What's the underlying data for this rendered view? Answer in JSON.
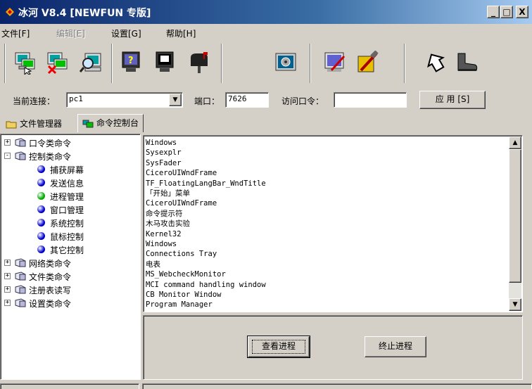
{
  "window": {
    "title": "冰河 V8.4 [NEWFUN 专版]",
    "controls": {
      "minimize": "_",
      "maximize": "□",
      "close": "X"
    }
  },
  "menu": {
    "items": [
      {
        "label": "文件[F]",
        "enabled": true
      },
      {
        "label": "编辑[E]",
        "enabled": false
      },
      {
        "label": "设置[G]",
        "enabled": true
      },
      {
        "label": "帮助[H]",
        "enabled": true
      }
    ]
  },
  "toolbar": {
    "buttons": [
      {
        "icon": "connect-computer-icon"
      },
      {
        "icon": "disconnect-computer-icon"
      },
      {
        "icon": "search-computer-icon"
      },
      {
        "icon": "computer-help-icon"
      },
      {
        "icon": "monitor-icon"
      },
      {
        "icon": "mailbox-icon"
      },
      {
        "icon": "control-panel-icon"
      },
      {
        "icon": "edit-config-icon"
      },
      {
        "icon": "tools-icon"
      },
      {
        "icon": "arrow-icon"
      },
      {
        "icon": "boot-icon"
      }
    ]
  },
  "connection": {
    "current_label": "当前连接：",
    "current_value": "pc1",
    "port_label": "端口：",
    "port_value": "7626",
    "password_label": "访问口令：",
    "password_value": "",
    "apply_label": "应 用 [S]"
  },
  "tabs": [
    {
      "label": "文件管理器",
      "active": false
    },
    {
      "label": "命令控制台",
      "active": true
    }
  ],
  "tree": {
    "items": [
      {
        "label": "口令类命令",
        "level": 0,
        "expander": "+"
      },
      {
        "label": "控制类命令",
        "level": 0,
        "expander": "-"
      },
      {
        "label": "捕获屏幕",
        "level": 1,
        "dot": "#0000cc"
      },
      {
        "label": "发送信息",
        "level": 1,
        "dot": "#0000cc"
      },
      {
        "label": "进程管理",
        "level": 1,
        "dot": "#00aa00"
      },
      {
        "label": "窗口管理",
        "level": 1,
        "dot": "#0000cc"
      },
      {
        "label": "系统控制",
        "level": 1,
        "dot": "#0000cc"
      },
      {
        "label": "鼠标控制",
        "level": 1,
        "dot": "#0000cc"
      },
      {
        "label": "其它控制",
        "level": 1,
        "dot": "#0000cc"
      },
      {
        "label": "网络类命令",
        "level": 0,
        "expander": "+"
      },
      {
        "label": "文件类命令",
        "level": 0,
        "expander": "+"
      },
      {
        "label": "注册表读写",
        "level": 0,
        "expander": "+"
      },
      {
        "label": "设置类命令",
        "level": 0,
        "expander": "+"
      }
    ]
  },
  "window_list": [
    "Windows",
    "Sysexplr",
    "SysFader",
    "CiceroUIWndFrame",
    "TF_FloatingLangBar_WndTitle",
    "「开始」菜单",
    "CiceroUIWndFrame",
    "命令提示符",
    "木马攻击实验",
    "Kernel32",
    "Windows",
    "Connections Tray",
    "电表",
    "MS_WebcheckMonitor",
    "MCI command handling window",
    "CB Monitor Window",
    "Program Manager"
  ],
  "actions": {
    "view_process": "查看进程",
    "kill_process": "终止进程"
  },
  "colors": {
    "title_gradient_start": "#0a246a",
    "title_gradient_end": "#a6caf0",
    "face": "#d4d0c8"
  }
}
